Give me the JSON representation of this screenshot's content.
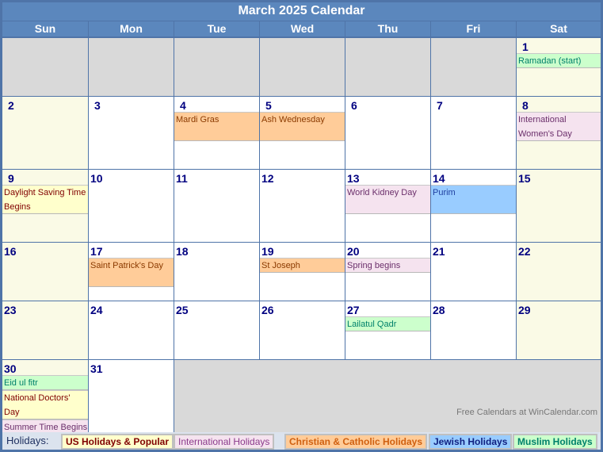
{
  "title": "March 2025 Calendar",
  "weekdays": [
    "Sun",
    "Mon",
    "Tue",
    "Wed",
    "Thu",
    "Fri",
    "Sat"
  ],
  "days": {
    "d1": {
      "num": "1",
      "events": [
        {
          "text": "Ramadan (start)",
          "type": "muslim"
        }
      ]
    },
    "d2": {
      "num": "2"
    },
    "d3": {
      "num": "3"
    },
    "d4": {
      "num": "4",
      "events": [
        {
          "text": "Mardi Gras",
          "type": "christian"
        }
      ]
    },
    "d5": {
      "num": "5",
      "events": [
        {
          "text": "Ash Wednesday",
          "type": "christian"
        }
      ]
    },
    "d6": {
      "num": "6"
    },
    "d7": {
      "num": "7"
    },
    "d8": {
      "num": "8",
      "events": [
        {
          "text": "International Women's Day",
          "type": "intl"
        }
      ]
    },
    "d9": {
      "num": "9",
      "events": [
        {
          "text": "Daylight Saving Time Begins",
          "type": "us"
        }
      ]
    },
    "d10": {
      "num": "10"
    },
    "d11": {
      "num": "11"
    },
    "d12": {
      "num": "12"
    },
    "d13": {
      "num": "13",
      "events": [
        {
          "text": "World Kidney Day",
          "type": "intl"
        }
      ]
    },
    "d14": {
      "num": "14",
      "events": [
        {
          "text": "Purim",
          "type": "jewish"
        }
      ]
    },
    "d15": {
      "num": "15"
    },
    "d16": {
      "num": "16"
    },
    "d17": {
      "num": "17",
      "events": [
        {
          "text": "Saint Patrick's Day",
          "type": "christian"
        }
      ]
    },
    "d18": {
      "num": "18"
    },
    "d19": {
      "num": "19",
      "events": [
        {
          "text": "St Joseph",
          "type": "christian"
        }
      ]
    },
    "d20": {
      "num": "20",
      "events": [
        {
          "text": "Spring begins",
          "type": "intl"
        }
      ]
    },
    "d21": {
      "num": "21"
    },
    "d22": {
      "num": "22"
    },
    "d23": {
      "num": "23"
    },
    "d24": {
      "num": "24"
    },
    "d25": {
      "num": "25"
    },
    "d26": {
      "num": "26"
    },
    "d27": {
      "num": "27",
      "events": [
        {
          "text": "Lailatul Qadr",
          "type": "muslim"
        }
      ]
    },
    "d28": {
      "num": "28"
    },
    "d29": {
      "num": "29"
    },
    "d30": {
      "num": "30",
      "events": [
        {
          "text": "Eid ul fitr",
          "type": "muslim"
        },
        {
          "text": "National Doctors' Day",
          "type": "us"
        },
        {
          "text": "Summer Time Begins (Europe)",
          "type": "intl"
        }
      ]
    },
    "d31": {
      "num": "31"
    }
  },
  "credit": "Free Calendars at WinCalendar.com",
  "legend": {
    "label": "Holidays:",
    "items": [
      {
        "text": "US Holidays & Popular",
        "type": "us"
      },
      {
        "text": "International Holidays",
        "type": "intl"
      },
      {
        "text": "Christian & Catholic Holidays",
        "type": "christian"
      },
      {
        "text": "Jewish Holidays",
        "type": "jewish"
      },
      {
        "text": "Muslim Holidays",
        "type": "muslim"
      }
    ]
  }
}
